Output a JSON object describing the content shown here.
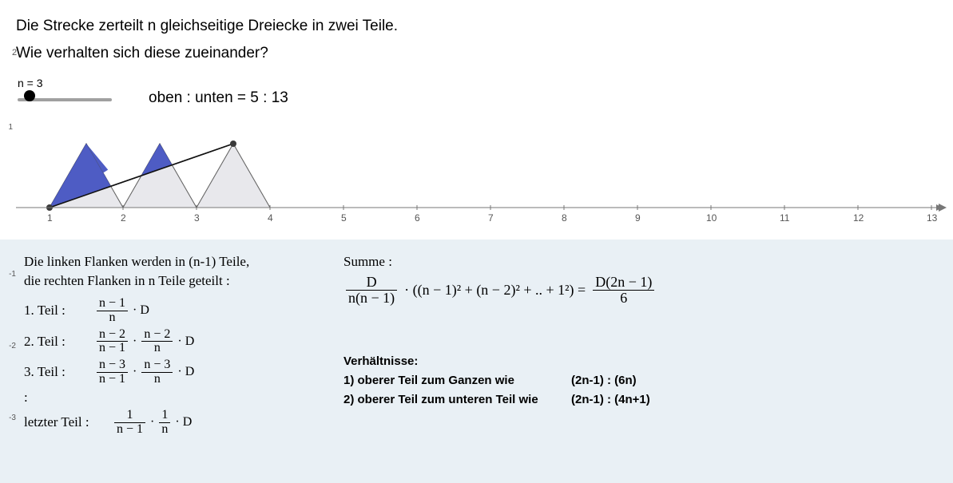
{
  "title": {
    "line1": "Die Strecke zerteilt n gleichseitige Dreiecke in zwei Teile.",
    "line2": "Wie verhalten sich diese zueinander?"
  },
  "slider": {
    "label": "n = 3",
    "min": 1,
    "max": 12,
    "value": 3
  },
  "ratio_text": "oben : unten = 5 : 13",
  "yaxis": {
    "ticks": [
      "1",
      "-1",
      "-2",
      "-3"
    ],
    "sup_mark": "2"
  },
  "xaxis": {
    "ticks": [
      "1",
      "2",
      "3",
      "4",
      "5",
      "6",
      "7",
      "8",
      "9",
      "10",
      "11",
      "12",
      "13"
    ]
  },
  "left_block": {
    "line1": "Die linken Flanken werden in (n-1) Teile,",
    "line2": "die rechten Flanken in n Teile geteilt :",
    "part1_label": "1. Teil :",
    "part1_frac_num": "n − 1",
    "part1_frac_den": "n",
    "part1_tail": "· D",
    "part2_label": "2. Teil :",
    "part2_f1_num": "n − 2",
    "part2_f1_den": "n − 1",
    "part2_f2_num": "n − 2",
    "part2_f2_den": "n",
    "part2_tail": "· D",
    "part3_label": "3. Teil :",
    "part3_f1_num": "n − 3",
    "part3_f1_den": "n − 1",
    "part3_f2_num": "n − 3",
    "part3_f2_den": "n",
    "part3_tail": "· D",
    "dots": ":",
    "last_label": "letzter Teil :",
    "last_f1_num": "1",
    "last_f1_den": "n − 1",
    "last_f2_num": "1",
    "last_f2_den": "n",
    "last_tail": "· D"
  },
  "right_block": {
    "sum_label": "Summe :",
    "sum_lhs_num": "D",
    "sum_lhs_den": "n(n − 1)",
    "sum_mid": "· ((n − 1)² + (n − 2)² + .. + 1²) =",
    "sum_rhs_num": "D(2n − 1)",
    "sum_rhs_den": "6",
    "ratios_title": "Verhältnisse:",
    "ratio1_a": "1) oberer Teil zum Ganzen wie",
    "ratio1_b": "(2n-1) : (6n)",
    "ratio2_a": "2) oberer Teil zum unteren Teil wie",
    "ratio2_b": "(2n-1) : (4n+1)"
  },
  "colors": {
    "triangle_fill": "#e8e8ec",
    "triangle_stroke": "#555",
    "upper_fill": "#4e5cc4",
    "axis": "#666"
  },
  "chart_data": {
    "type": "diagram",
    "n": 3,
    "triangles": [
      {
        "baseL": 1,
        "baseR": 2,
        "apex": 1.5
      },
      {
        "baseL": 2,
        "baseR": 3,
        "apex": 2.5
      },
      {
        "baseL": 3,
        "baseR": 4,
        "apex": 3.5
      }
    ],
    "cut_line": {
      "x1": 1,
      "y1": 0,
      "x2": 3.5,
      "y2": 0.866
    },
    "height": 0.866,
    "xlim": [
      0,
      13.2
    ],
    "ylim": [
      -3.2,
      1.3
    ]
  }
}
